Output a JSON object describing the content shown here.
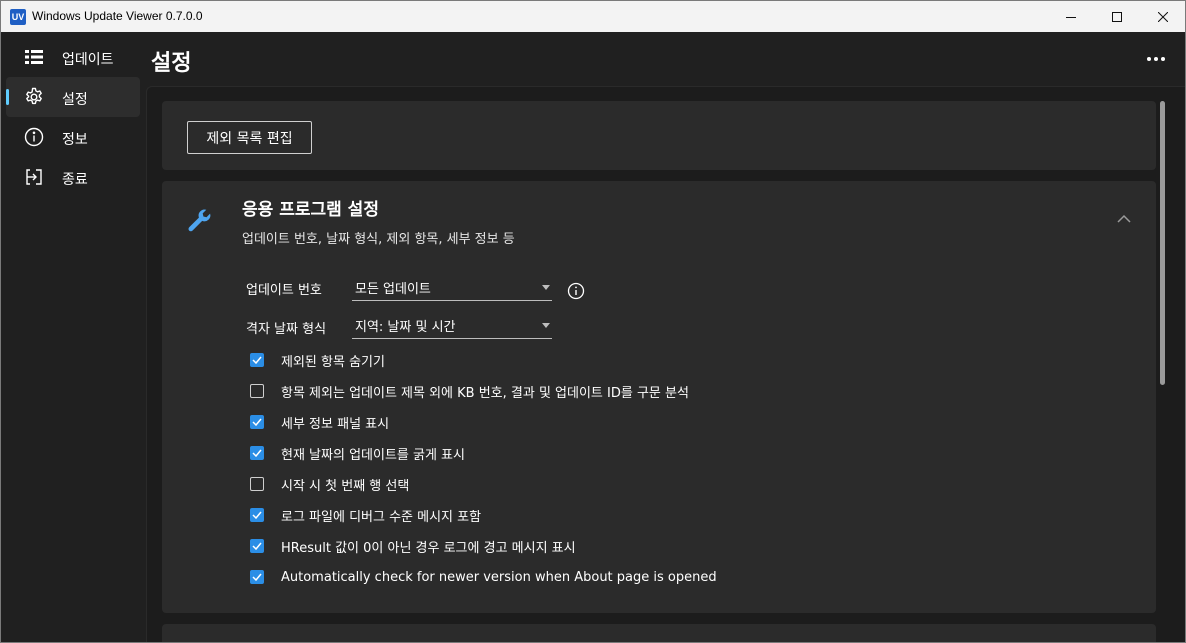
{
  "window": {
    "icon_text": "UV",
    "title": "Windows Update Viewer  0.7.0.0"
  },
  "sidebar": {
    "items": [
      {
        "label": "업데이트",
        "icon": "list-icon",
        "active": false
      },
      {
        "label": "설정",
        "icon": "gear-icon",
        "active": true
      },
      {
        "label": "정보",
        "icon": "info-icon",
        "active": false
      },
      {
        "label": "종료",
        "icon": "exit-icon",
        "active": false
      }
    ]
  },
  "header": {
    "title": "설정"
  },
  "edit_card": {
    "button_label": "제외 목록 편집"
  },
  "app_settings": {
    "title": "응용 프로그램 설정",
    "subtitle": "업데이트 번호, 날짜 형식, 제외 항목, 세부 정보 등",
    "update_number": {
      "label": "업데이트 번호",
      "value": "모든 업데이트"
    },
    "date_format": {
      "label": "격자 날짜 형식",
      "value": "지역: 날짜 및 시간"
    },
    "checkboxes": [
      {
        "label": "제외된 항목 숨기기",
        "checked": true
      },
      {
        "label": "항목 제외는 업데이트 제목 외에 KB 번호, 결과 및 업데이트 ID를 구문 분석",
        "checked": false
      },
      {
        "label": "세부 정보 패널 표시",
        "checked": true
      },
      {
        "label": "현재 날짜의 업데이트를 굵게 표시",
        "checked": true
      },
      {
        "label": "시작 시 첫 번째 행 선택",
        "checked": false
      },
      {
        "label": "로그 파일에 디버그 수준 메시지 포함",
        "checked": true
      },
      {
        "label": "HResult 값이 0이 아닌 경우 로그에 경고 메시지 표시",
        "checked": true
      },
      {
        "label": "Automatically check for newer version when About page is opened",
        "checked": true
      }
    ]
  },
  "colors": {
    "accent": "#60cdff",
    "checkbox_on": "#2b8ee6",
    "card": "#2b2b2b",
    "background": "#202020"
  }
}
